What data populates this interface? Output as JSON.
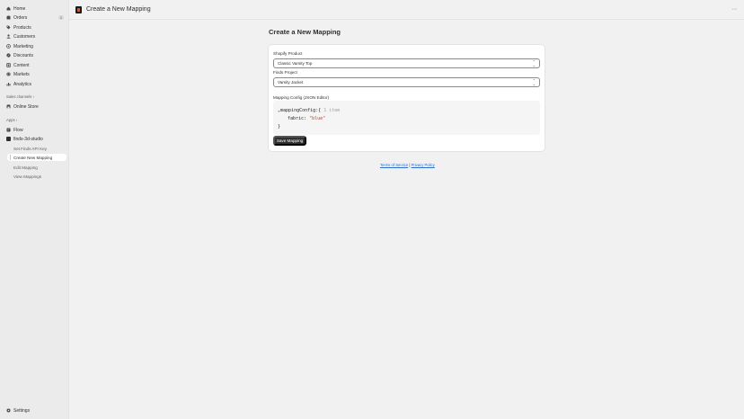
{
  "sidebar": {
    "main_items": [
      {
        "label": "Home",
        "icon": "home-icon"
      },
      {
        "label": "Orders",
        "icon": "orders-icon",
        "badge": "2"
      },
      {
        "label": "Products",
        "icon": "tag-icon"
      },
      {
        "label": "Customers",
        "icon": "person-icon"
      },
      {
        "label": "Marketing",
        "icon": "target-icon"
      },
      {
        "label": "Discounts",
        "icon": "discount-icon"
      },
      {
        "label": "Content",
        "icon": "content-icon"
      },
      {
        "label": "Markets",
        "icon": "globe-icon"
      },
      {
        "label": "Analytics",
        "icon": "chart-icon"
      }
    ],
    "sales_channels_label": "Sales channels",
    "sales_channels": [
      {
        "label": "Online Store",
        "icon": "store-icon"
      }
    ],
    "apps_label": "Apps",
    "apps": [
      {
        "label": "Flow",
        "icon": "flow-icon"
      },
      {
        "label": "finds-3d-studio",
        "icon": "app-icon"
      }
    ],
    "app_subitems": [
      {
        "label": "Set Finds API Key"
      },
      {
        "label": "Create New Mapping",
        "active": true
      },
      {
        "label": "Edit Mapping"
      },
      {
        "label": "View Mappings"
      }
    ],
    "settings_label": "Settings"
  },
  "topbar": {
    "title": "Create a New Mapping",
    "more_label": "⋯"
  },
  "main": {
    "page_title": "Create a New Mapping",
    "shopify_product_label": "Shopify Product",
    "shopify_product_value": "Classic Varsity Top",
    "finds_project_label": "Finds Project",
    "finds_project_value": "Varsity Jacket",
    "mapping_config_label": "Mapping Config (JSON Editor)",
    "code": {
      "line1_key": "mappingConfig",
      "line1_rest": ":{",
      "line1_hint": " 1 item",
      "line2_key": "fabric",
      "line2_value": "\"blue\"",
      "line3": "}"
    },
    "save_button": "Save Mapping",
    "footer": {
      "terms": "Terms of Service",
      "separator": "|",
      "privacy": "Privacy Policy"
    }
  },
  "colors": {
    "primary_button": "#303030",
    "link": "#2c6ecb",
    "string_value": "#c0392b"
  }
}
